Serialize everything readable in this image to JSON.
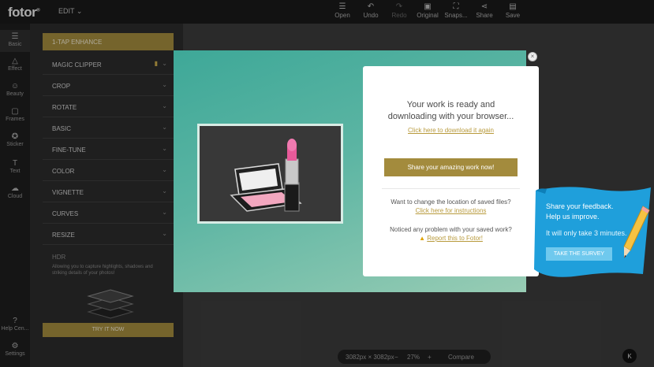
{
  "app": {
    "logo_text": "fotor",
    "logo_mark": "®",
    "edit_menu": "EDIT"
  },
  "toolbar": {
    "items": [
      {
        "label": "Open",
        "icon": "hamburger-icon"
      },
      {
        "label": "Undo",
        "icon": "undo-icon"
      },
      {
        "label": "Redo",
        "icon": "redo-icon"
      },
      {
        "label": "Original",
        "icon": "image-icon"
      },
      {
        "label": "Snaps...",
        "icon": "snapshot-icon"
      },
      {
        "label": "Share",
        "icon": "share-icon"
      },
      {
        "label": "Save",
        "icon": "save-icon"
      }
    ]
  },
  "rail": {
    "items": [
      {
        "label": "Basic"
      },
      {
        "label": "Effect"
      },
      {
        "label": "Beauty"
      },
      {
        "label": "Frames"
      },
      {
        "label": "Sticker"
      },
      {
        "label": "Text"
      },
      {
        "label": "Cloud"
      }
    ],
    "help": "Help Cen...",
    "settings": "Settings"
  },
  "panel": {
    "header": "1-TAP ENHANCE",
    "items": [
      "MAGIC CLIPPER",
      "CROP",
      "ROTATE",
      "BASIC",
      "FINE-TUNE",
      "COLOR",
      "VIGNETTE",
      "CURVES",
      "RESIZE"
    ],
    "feature_title": "HDR",
    "feature_desc": "Allowing you to capture highlights, shadows and striking details of your photos!",
    "try_label": "TRY IT NOW"
  },
  "zoombar": {
    "dims": "3082px × 3082px",
    "minus": "−",
    "zoom": "27%",
    "plus": "+",
    "compare": "Compare"
  },
  "corner_button": "K",
  "modal": {
    "close": "×",
    "title_line1": "Your work is ready and",
    "title_line2": "downloading with your browser...",
    "download_link": "Click here to download it again",
    "share_button": "Share your amazing work now!",
    "change_text": "Want to change the location of saved files?",
    "instructions_link": "Click here for instructions",
    "problem_text": "Noticed any problem with your saved work?",
    "report_link": "Report this to Fotor!"
  },
  "survey": {
    "line1": "Share your feedback.",
    "line2": "Help us improve.",
    "line3": "It will only take 3 minutes.",
    "button": "TAKE THE SURVEY"
  },
  "colors": {
    "accent_gold": "#a38b3d",
    "link_gold": "#b89a3c",
    "survey_blue": "#1f9fdb",
    "modal_teal": "#3ea898"
  }
}
